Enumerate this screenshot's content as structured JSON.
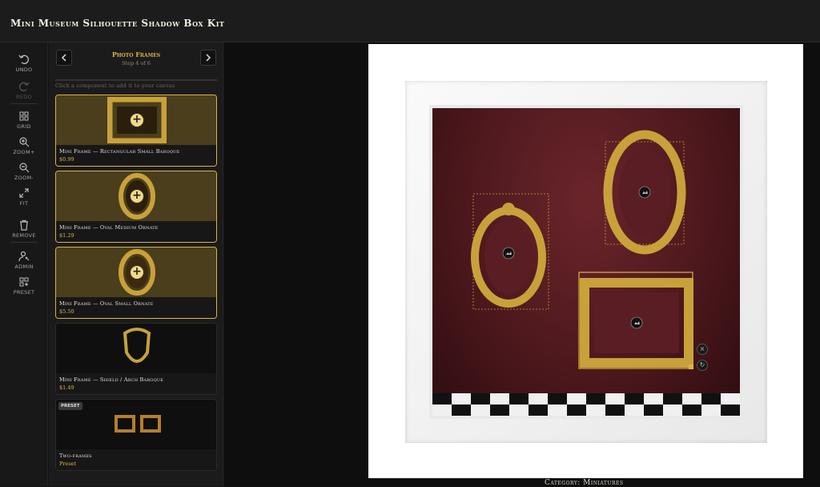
{
  "app": {
    "title": "Mini Museum Silhouette Shadow Box Kit"
  },
  "toolbar": {
    "items": [
      {
        "label": "UNDO",
        "icon": "undo-icon",
        "enabled": true
      },
      {
        "label": "REDO",
        "icon": "redo-icon",
        "enabled": false
      },
      {
        "label": "GRID",
        "icon": "grid-icon",
        "enabled": true
      },
      {
        "label": "ZOOM+",
        "icon": "zoom-in-icon",
        "enabled": true
      },
      {
        "label": "ZOOM-",
        "icon": "zoom-out-icon",
        "enabled": true
      },
      {
        "label": "FIT",
        "icon": "fit-icon",
        "enabled": true
      },
      {
        "label": "REMOVE",
        "icon": "trash-icon",
        "enabled": true
      },
      {
        "label": "ADMIN",
        "icon": "admin-icon",
        "enabled": true
      },
      {
        "label": "PRESET",
        "icon": "preset-icon",
        "enabled": true
      }
    ]
  },
  "panel": {
    "step_title": "Photo Frames",
    "step_sub": "Step 4 of 6",
    "hint": "Click a component to add it to your canvas",
    "cards": [
      {
        "name": "Mini Frame — Rectangular Small Baroque",
        "price": "$0.99",
        "selected": true,
        "shape": "rect"
      },
      {
        "name": "Mini Frame — Oval Medium Ornate",
        "price": "$1.29",
        "selected": true,
        "shape": "oval"
      },
      {
        "name": "Mini Frame — Oval Small Ornate",
        "price": "$5.50",
        "selected": true,
        "shape": "oval"
      },
      {
        "name": "Mini Frame — Shield / Arch Baroque",
        "price": "$1.49",
        "selected": false,
        "shape": "shield"
      },
      {
        "name": "Two-frames",
        "price": "Preset",
        "selected": false,
        "shape": "two",
        "badge": "PRESET"
      }
    ]
  },
  "colors": {
    "accent": "#d9b544",
    "velvet": "#4d181d",
    "gold": "#c9a13a"
  },
  "footer": {
    "caption": "Category: Miniatures"
  }
}
